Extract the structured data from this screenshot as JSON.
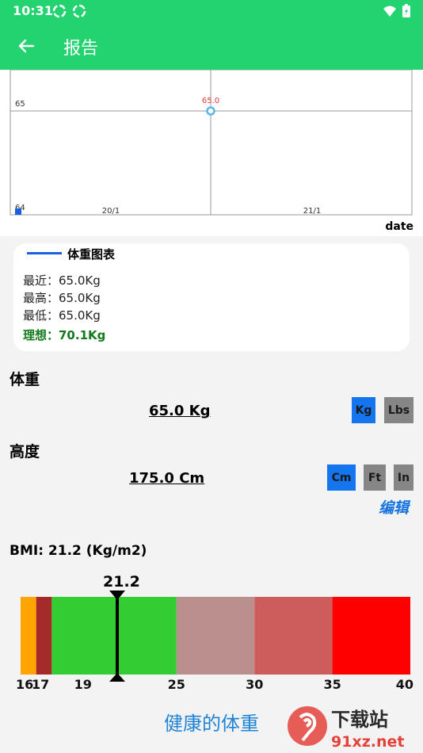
{
  "status_bar": {
    "time": "10:31"
  },
  "app_bar": {
    "title": "报告"
  },
  "chart_data": {
    "type": "line",
    "series": [
      {
        "name": "体重图表",
        "points": [
          {
            "x": "21/1",
            "y": 65.0
          }
        ]
      }
    ],
    "y_ticks": [
      "64",
      "65"
    ],
    "x_ticks": [
      "20/1",
      "21/1"
    ],
    "point_label": "65.0",
    "xlabel": "date",
    "ylim": [
      64,
      65
    ],
    "colors": {
      "line": "#1a5fe0",
      "point": "#59b8e6",
      "label": "#e23b3b"
    },
    "grid": true
  },
  "summary": {
    "legend": "体重图表",
    "recent": "最近：65.0Kg",
    "highest": "最高：65.0Kg",
    "lowest": "最低：65.0Kg",
    "ideal": "理想：70.1Kg"
  },
  "weight": {
    "title": "体重",
    "value": "65.0 Kg",
    "units": [
      "Kg",
      "Lbs"
    ],
    "selected": "Kg"
  },
  "height": {
    "title": "高度",
    "value": "175.0 Cm",
    "units": [
      "Cm",
      "Ft",
      "In"
    ],
    "selected": "Cm",
    "edit": "编辑"
  },
  "bmi": {
    "title": "BMI: 21.2 (Kg/m2)",
    "value": 21.2,
    "value_label": "21.2",
    "status": "健康的体重",
    "scale_min": 15,
    "scale_max": 40,
    "bands": [
      {
        "from": 15,
        "to": 16,
        "color": "#ffa400"
      },
      {
        "from": 16,
        "to": 17,
        "color": "#a52a2a"
      },
      {
        "from": 17,
        "to": 25,
        "color": "#33cc33"
      },
      {
        "from": 25,
        "to": 30,
        "color": "#bc8f8f"
      },
      {
        "from": 30,
        "to": 35,
        "color": "#cd5c5c"
      },
      {
        "from": 35,
        "to": 40,
        "color": "#ff0000"
      }
    ],
    "ticks": [
      {
        "value": 16,
        "label": "16"
      },
      {
        "value": 17,
        "label": "17"
      },
      {
        "value": 19,
        "label": "19"
      },
      {
        "value": 25,
        "label": "25"
      },
      {
        "value": 30,
        "label": "30"
      },
      {
        "value": 35,
        "label": "35"
      },
      {
        "value": 40,
        "label": "40"
      }
    ]
  },
  "watermark": {
    "top_text": "下载站",
    "bottom_text": "91xz.net"
  },
  "colors": {
    "app_bar": "#22d36f",
    "selected_unit": "#1475ef",
    "unselected_unit": "#868686",
    "ideal": "#127a1c",
    "link": "#1673e0"
  }
}
